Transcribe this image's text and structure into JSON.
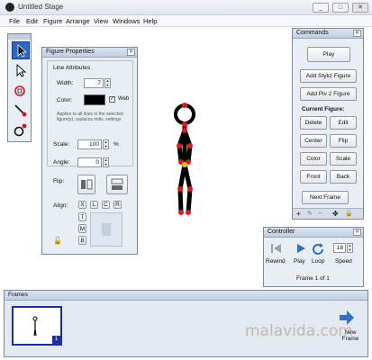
{
  "window": {
    "title": "Untitled Stage",
    "buttons": [
      "_",
      "□",
      "✕"
    ]
  },
  "menu": [
    "File",
    "Edit",
    "Figure",
    "Arrange",
    "View",
    "Windows",
    "Help"
  ],
  "tools": [
    "select-arrow",
    "node-arrow",
    "scale-target",
    "pen",
    "rotate-joint"
  ],
  "figure_properties": {
    "title": "Figure Properties",
    "line_attributes": "Line Attributes",
    "width_label": "Width:",
    "width_value": "7",
    "color_label": "Color:",
    "color_value": "#000000",
    "web_label": "Web",
    "web_checked": true,
    "note": "Applies to all lines in the selected figure(s), replaces indiv. settings",
    "scale_label": "Scale:",
    "scale_value": "100",
    "scale_unit": "%",
    "angle_label": "Angle:",
    "angle_value": "0",
    "flip_label": "Flip:",
    "align_label": "Align:",
    "align_h": [
      "X",
      "L",
      "C",
      "R"
    ],
    "align_v": [
      "T",
      "M",
      "B"
    ]
  },
  "commands": {
    "title": "Commands",
    "play": "Play",
    "add_stykz": "Add Stykz Figure",
    "add_piv2": "Add Piv 2 Figure",
    "current_figure": "Current Figure:",
    "delete": "Delete",
    "edit": "Edit",
    "center": "Center",
    "flip": "Flip",
    "color": "Color",
    "scale": "Scale",
    "front": "Front",
    "back": "Back",
    "next_frame": "Next Frame",
    "bottom_icons": [
      "plus",
      "pencil",
      "minus",
      "move",
      "lock"
    ]
  },
  "controller": {
    "title": "Controller",
    "rewind": "Rewind",
    "play": "Play",
    "loop": "Loop",
    "speed": "Speed",
    "speed_value": "18",
    "frame_info": "Frame 1 of 1"
  },
  "frames": {
    "title": "Frames",
    "frame_number": "1",
    "new_frame": "New Frame"
  },
  "watermark": "malavida.com",
  "colors": {
    "joint": "#e3161b",
    "stick": "#000000",
    "selection": "#1b2fa0",
    "accent": "#2a5fb0"
  }
}
